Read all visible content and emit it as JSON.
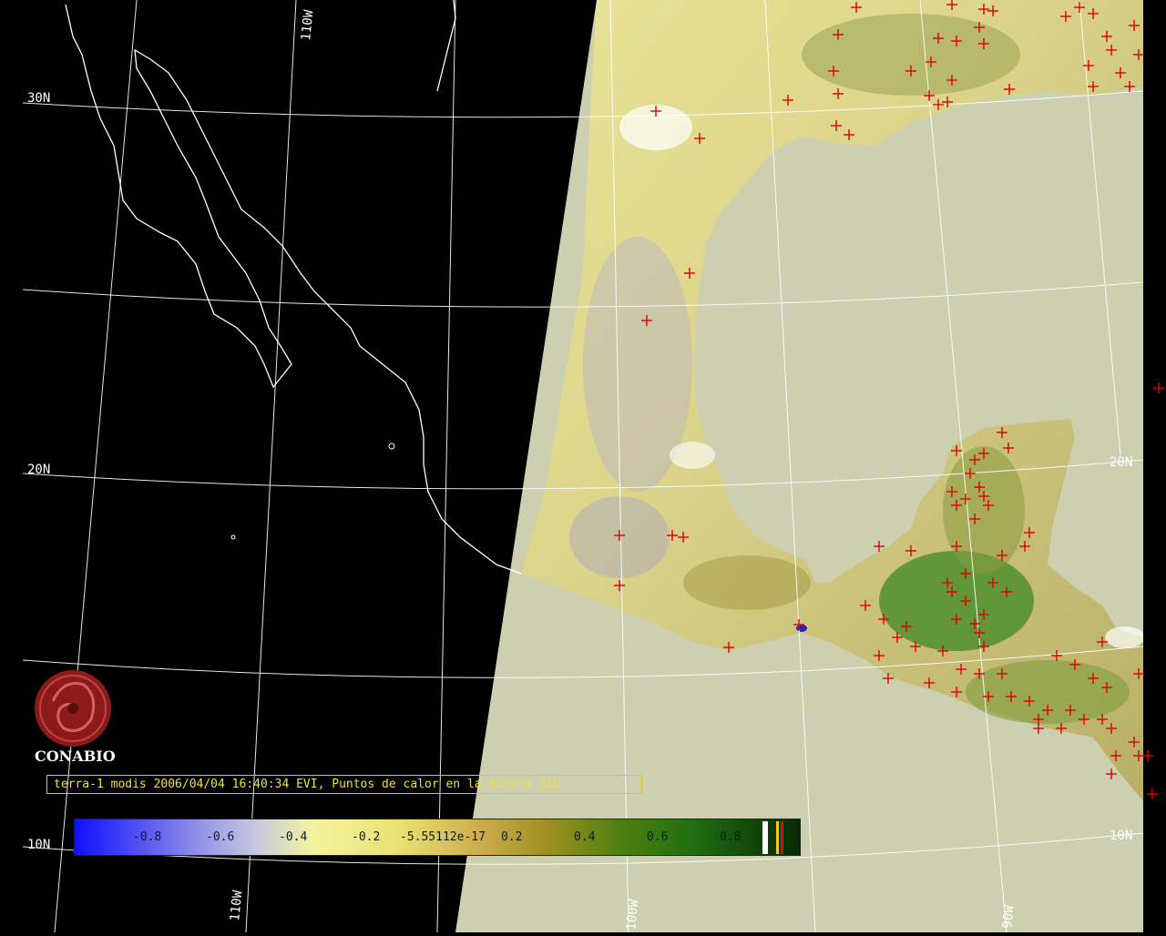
{
  "map": {
    "caption": "terra-1 modis 2006/04/04 16:40:34 EVI, Puntos de calor en la escena 315",
    "logo_text": "CONABIO",
    "graticule_labels": {
      "lat_30n": "30N",
      "lat_20n_left": "20N",
      "lat_20n_right": "20N",
      "lat_10n_left": "10N",
      "lat_10n_right": "10N",
      "lon_110w_top": "110W",
      "lon_110w_bottom": "110W",
      "lon_100w": "100W",
      "lon_90w": "90W"
    },
    "colorbar": {
      "labels": [
        "-0.8",
        "-0.6",
        "-0.4",
        "-0.2",
        "-5.55112e-17",
        "0.2",
        "0.4",
        "0.6",
        "0.8"
      ]
    },
    "colors": {
      "background": "#000000",
      "ocean": "#ccd0b0",
      "coastline": "#ffffff",
      "graticule": "#ffffff",
      "hotspot": "#e00000",
      "caption": "#f0e040",
      "logo": "#8b1a1a"
    }
  }
}
